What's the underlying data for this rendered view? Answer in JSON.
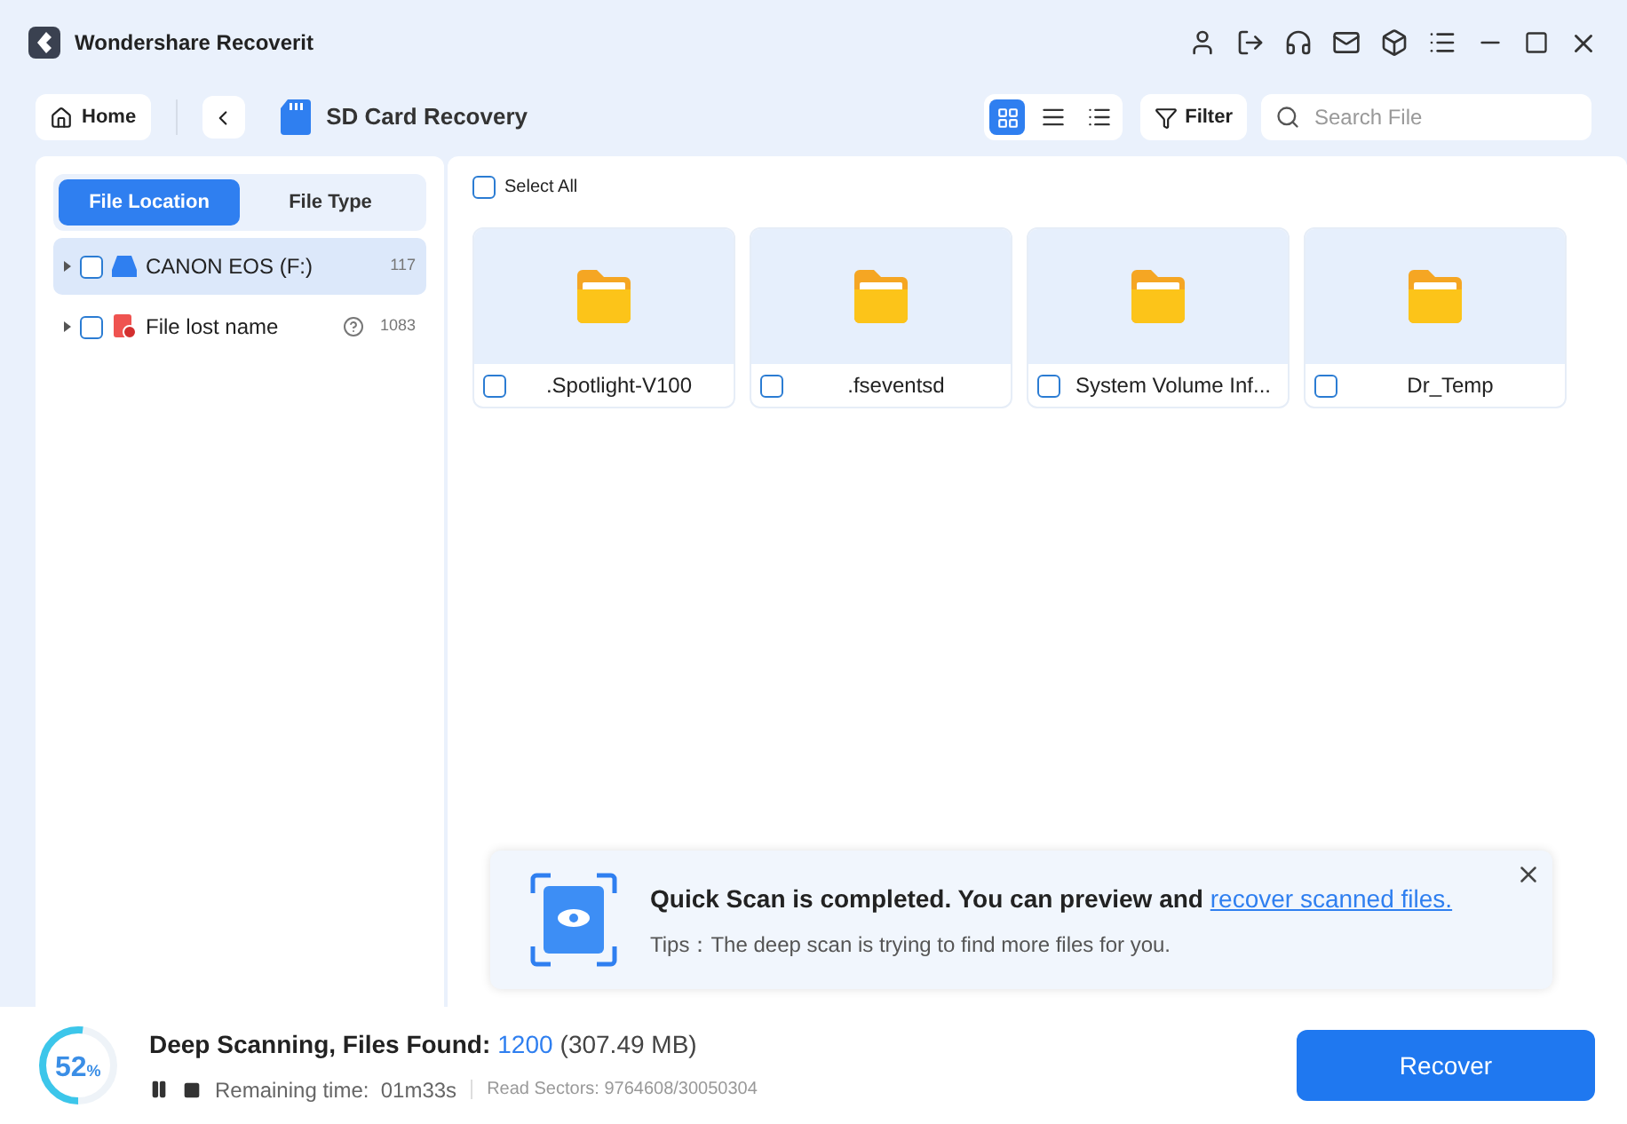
{
  "window": {
    "title": "Wondershare Recoverit"
  },
  "toolbar": {
    "home": "Home",
    "location": "SD Card Recovery",
    "views": [
      {
        "kind": "grid",
        "selected": true
      },
      {
        "kind": "detail",
        "selected": false
      },
      {
        "kind": "list",
        "selected": false
      }
    ],
    "filter": "Filter",
    "search": {
      "placeholder": "Search File"
    }
  },
  "sidebar": {
    "tabs": [
      {
        "label": "File Location",
        "selected": true
      },
      {
        "label": "File Type",
        "selected": false
      }
    ],
    "items": [
      {
        "kind": "drive",
        "name": "CANON EOS (F:)",
        "count": "117",
        "checked": false,
        "selected": true,
        "help": false
      },
      {
        "kind": "lost",
        "name": "File lost name",
        "count": "1083",
        "checked": false,
        "selected": false,
        "help": true
      }
    ]
  },
  "content": {
    "select_all": {
      "label": "Select All",
      "checked": false
    },
    "files": [
      {
        "name": ".Spotlight-V100",
        "checked": false
      },
      {
        "name": ".fseventsd",
        "checked": false
      },
      {
        "name": "System Volume Inf...",
        "checked": false
      },
      {
        "name": "Dr_Temp",
        "checked": false
      }
    ]
  },
  "notice": {
    "message": "Quick Scan is completed. You can preview and",
    "link": "recover scanned files.",
    "tip": "Tips：The deep scan is trying to find more files for you."
  },
  "status_bar": {
    "level": 0.52,
    "percent": "52",
    "percent_sign": "%",
    "label": "Deep Scanning, Files Found:",
    "count": "1200",
    "size": "(307.49 MB)",
    "remaining": "Remaining time:  01m33s",
    "sectors": "Read Sectors: 9764608/30050304",
    "recover": "Recover"
  }
}
